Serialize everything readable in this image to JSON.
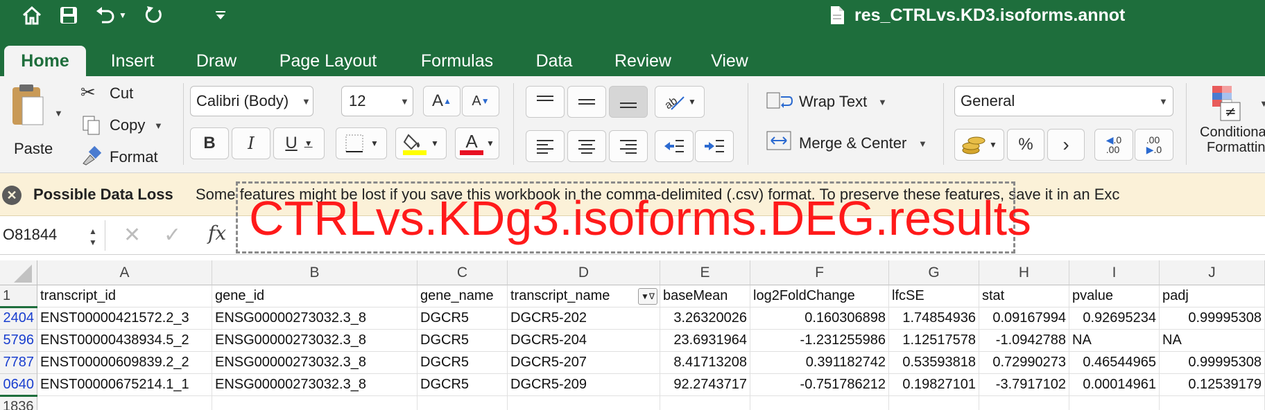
{
  "titlebar": {
    "document_title": "res_CTRLvs.KD3.isoforms.annot",
    "icons": [
      "home-icon",
      "save-icon",
      "undo-icon",
      "redo-icon",
      "customize-icon"
    ]
  },
  "tabs": [
    "Home",
    "Insert",
    "Draw",
    "Page Layout",
    "Formulas",
    "Data",
    "Review",
    "View"
  ],
  "ribbon": {
    "paste_label": "Paste",
    "cut_label": "Cut",
    "copy_label": "Copy",
    "format_label": "Format",
    "font_name": "Calibri (Body)",
    "font_size": "12",
    "wrap_text_label": "Wrap Text",
    "merge_center_label": "Merge & Center",
    "number_format": "General",
    "conditional_formatting_label_1": "Conditional",
    "conditional_formatting_label_2": "Formatting",
    "bold": "B",
    "italic": "I",
    "underline": "U",
    "percent": "%",
    "comma": "›",
    "font_color": "#e81123",
    "highlight_color": "#ffff00"
  },
  "notification": {
    "title": "Possible Data Loss",
    "message": "Some features might be lost if you save this workbook in the comma-delimited (.csv) format. To preserve these features, save it in an Exc"
  },
  "formula_bar": {
    "name_box": "O81844",
    "fx": "fx"
  },
  "overlay": {
    "text": "CTRLvs.KDg3.isoforms.DEG.results"
  },
  "grid": {
    "columns": [
      "A",
      "B",
      "C",
      "D",
      "E",
      "F",
      "G",
      "H",
      "I",
      "J"
    ],
    "header_row_num": "1",
    "headers": [
      "transcript_id",
      "gene_id",
      "gene_name",
      "transcript_name",
      "baseMean",
      "log2FoldChange",
      "lfcSE",
      "stat",
      "pvalue",
      "padj"
    ],
    "rows": [
      {
        "num": "2404",
        "cells": [
          "ENST00000421572.2_3",
          "ENSG00000273032.3_8",
          "DGCR5",
          "DGCR5-202",
          "3.26320026",
          "0.160306898",
          "1.74854936",
          "0.09167994",
          "0.92695234",
          "0.99995308"
        ]
      },
      {
        "num": "5796",
        "cells": [
          "ENST00000438934.5_2",
          "ENSG00000273032.3_8",
          "DGCR5",
          "DGCR5-204",
          "23.6931964",
          "-1.231255986",
          "1.12517578",
          "-1.0942788",
          "NA",
          "NA"
        ]
      },
      {
        "num": "7787",
        "cells": [
          "ENST00000609839.2_2",
          "ENSG00000273032.3_8",
          "DGCR5",
          "DGCR5-207",
          "8.41713208",
          "0.391182742",
          "0.53593818",
          "0.72990273",
          "0.46544965",
          "0.99995308"
        ]
      },
      {
        "num": "0640",
        "cells": [
          "ENST00000675214.1_1",
          "ENSG00000273032.3_8",
          "DGCR5",
          "DGCR5-209",
          "92.2743717",
          "-0.751786212",
          "0.19827101",
          "-3.7917102",
          "0.00014961",
          "0.12539179"
        ]
      }
    ],
    "last_row_num": "1836"
  }
}
